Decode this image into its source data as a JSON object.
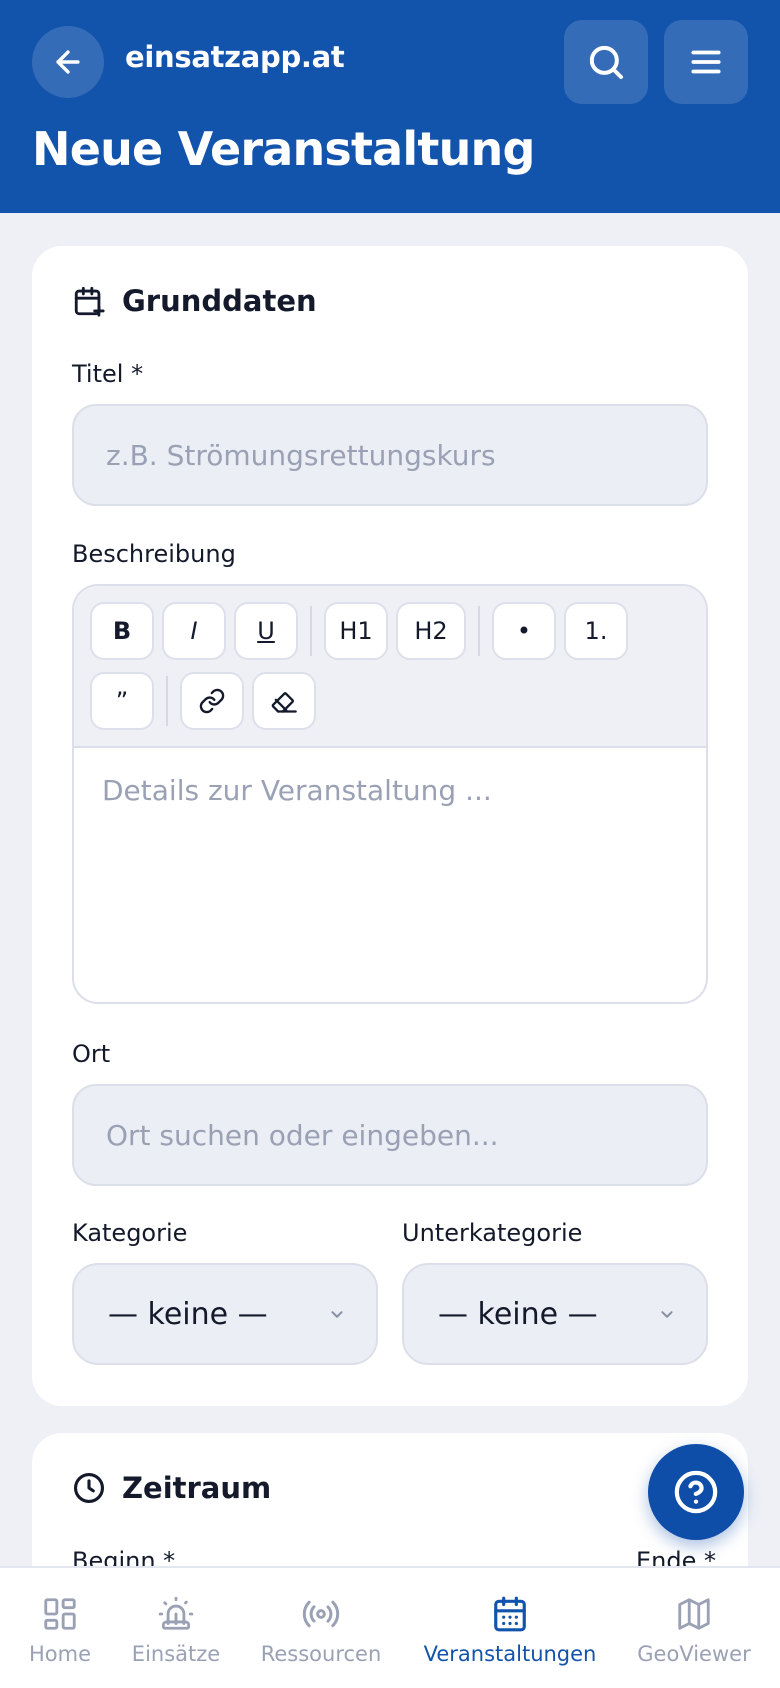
{
  "header": {
    "brand": "einsatzapp.at",
    "title": "Neue Veranstaltung",
    "color": "#1253ac"
  },
  "grunddaten": {
    "section_title": "Grunddaten",
    "titel_label": "Titel *",
    "titel_placeholder": "z.B. Strömungsrettungskurs",
    "beschreibung_label": "Beschreibung",
    "toolbar": {
      "bold": "B",
      "italic": "I",
      "underline": "U",
      "h1": "H1",
      "h2": "H2",
      "bullet": "•",
      "numbered": "1.",
      "quote": "”"
    },
    "beschreibung_placeholder": "Details zur Veranstaltung ...",
    "ort_label": "Ort",
    "ort_placeholder": "Ort suchen oder eingeben...",
    "kategorie_label": "Kategorie",
    "kategorie_value": "— keine —",
    "unterkategorie_label": "Unterkategorie",
    "unterkategorie_value": "— keine —"
  },
  "zeitraum": {
    "section_title": "Zeitraum",
    "beginn_label": "Beginn *",
    "ende_label": "Ende *"
  },
  "nav": {
    "items": [
      {
        "label": "Home",
        "icon": "grid-icon"
      },
      {
        "label": "Einsätze",
        "icon": "siren-icon"
      },
      {
        "label": "Ressourcen",
        "icon": "broadcast-icon"
      },
      {
        "label": "Veranstaltungen",
        "icon": "calendar-icon",
        "active": true
      },
      {
        "label": "GeoViewer",
        "icon": "map-icon"
      }
    ]
  }
}
